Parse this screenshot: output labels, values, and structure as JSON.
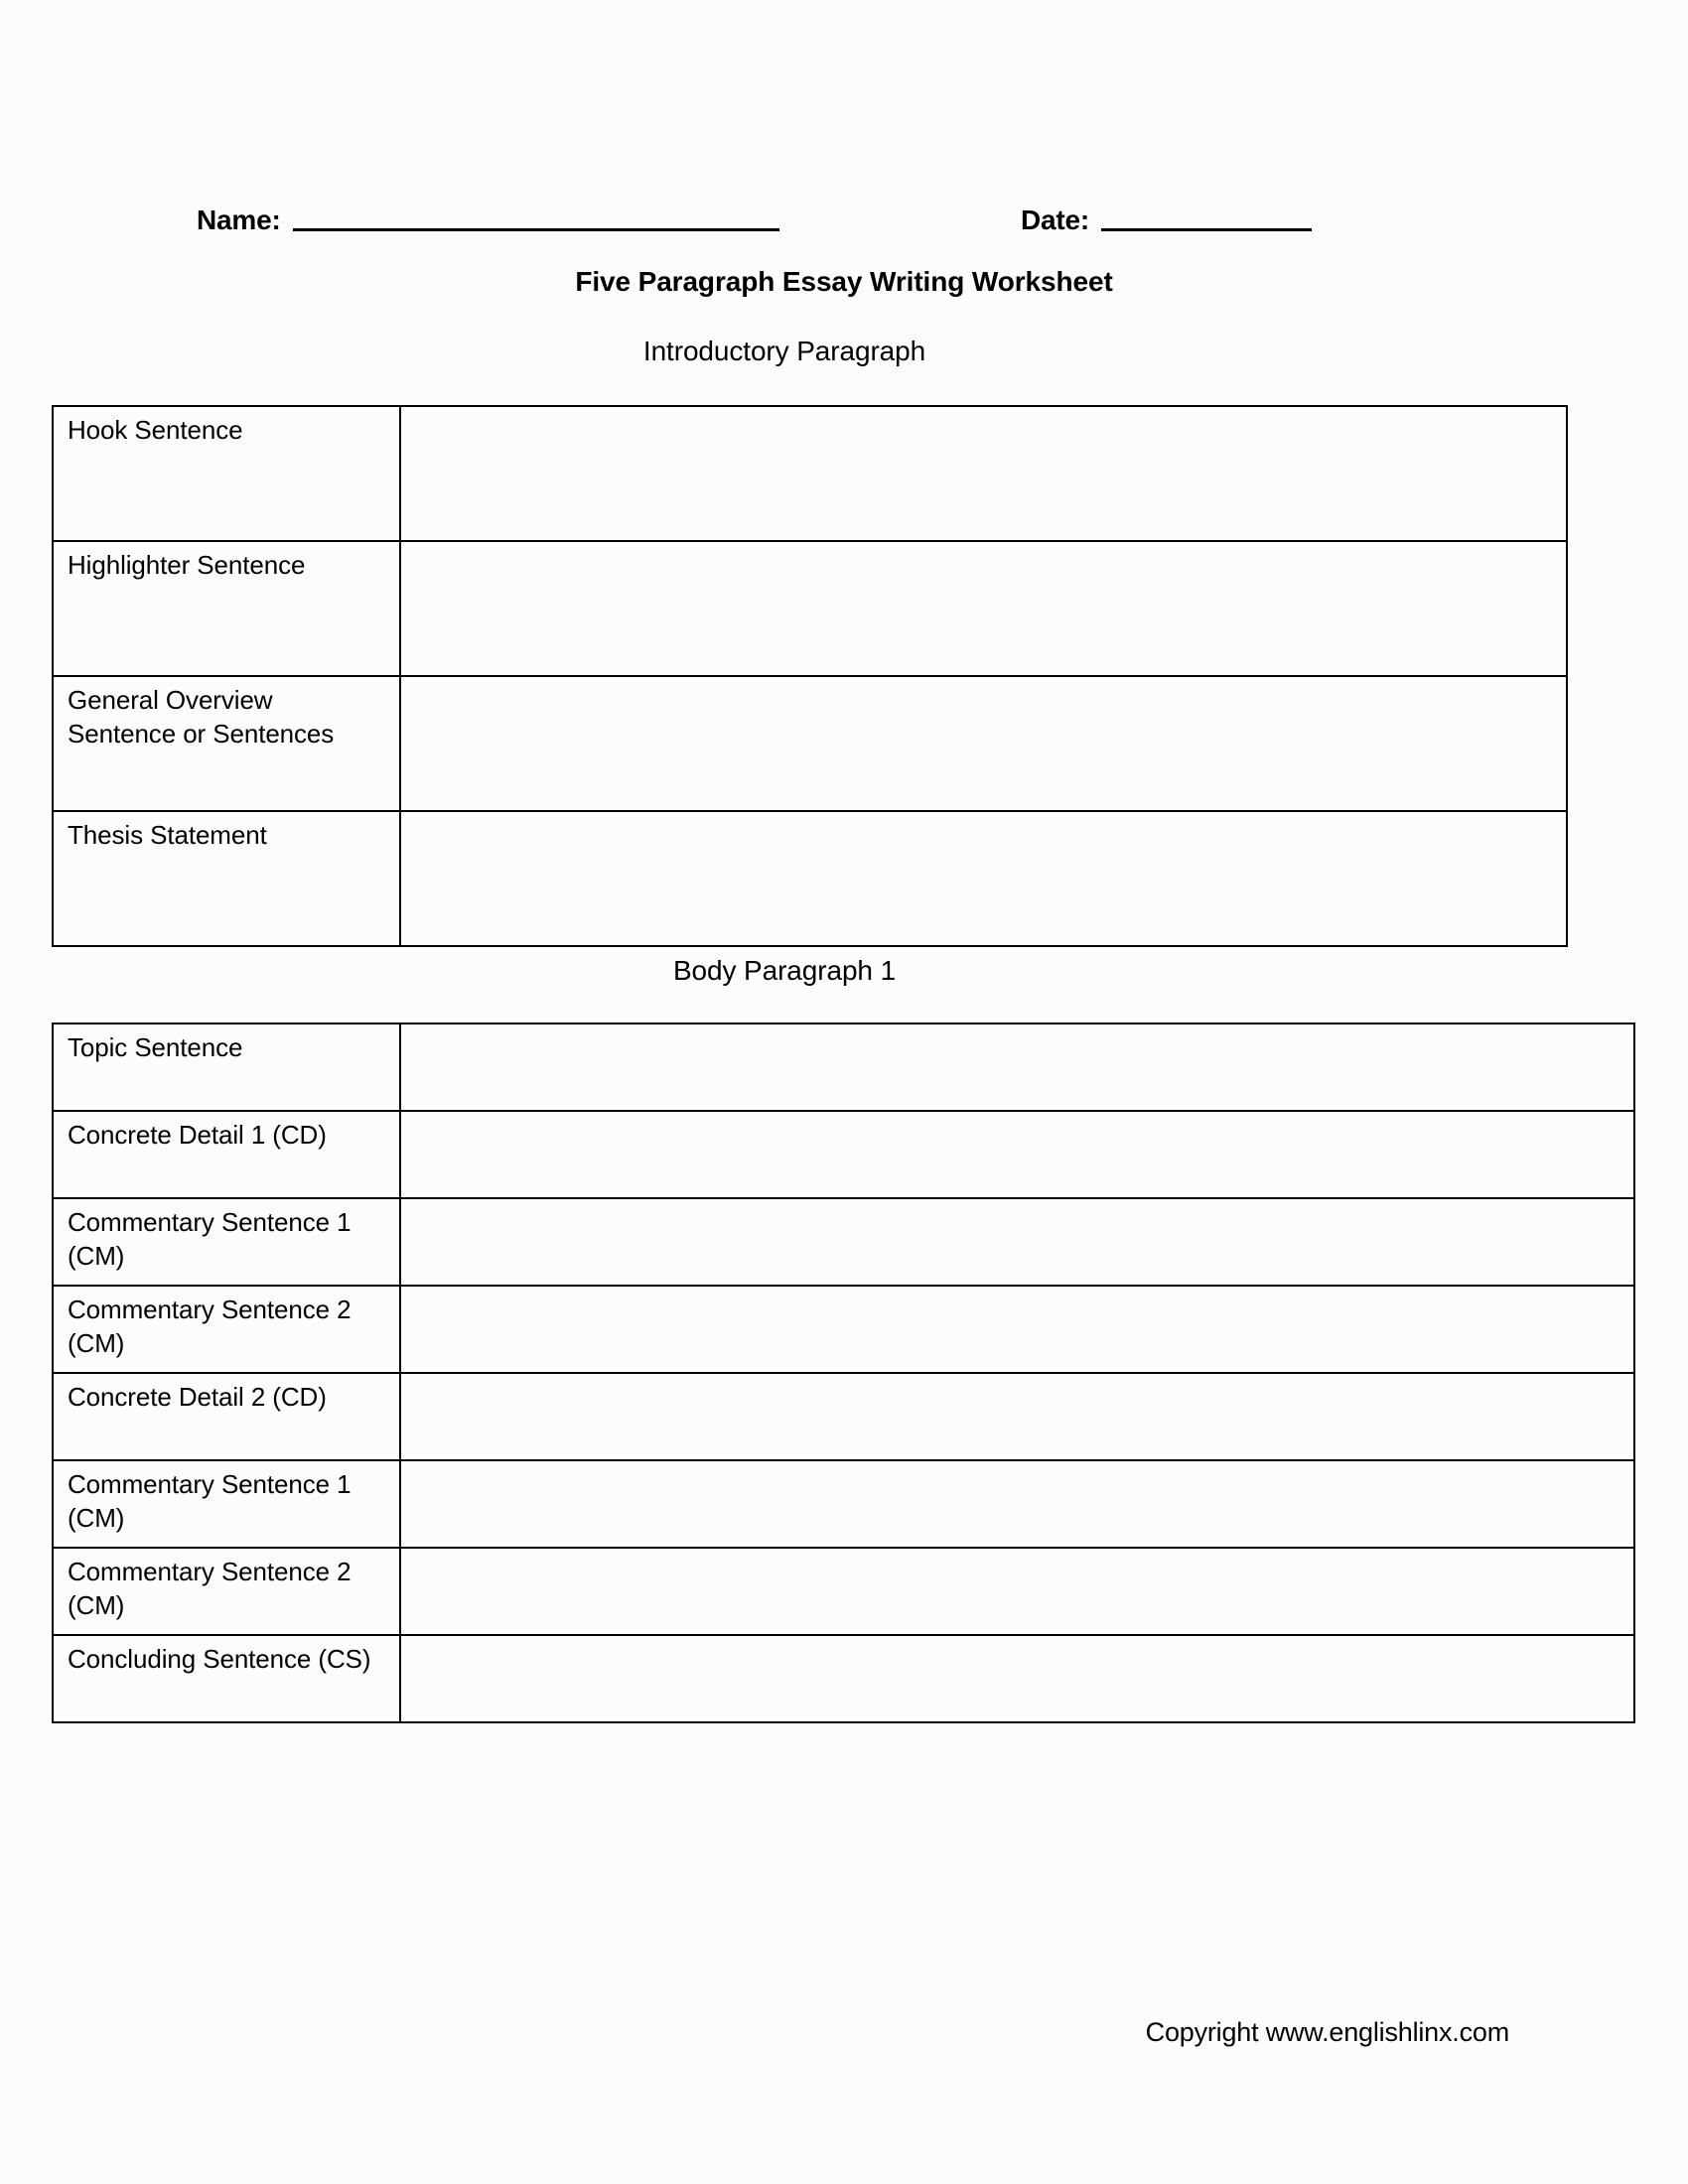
{
  "header": {
    "name_label": "Name:",
    "date_label": "Date:",
    "title": "Five Paragraph Essay Writing Worksheet"
  },
  "sections": [
    {
      "heading": "Introductory Paragraph",
      "rows": [
        {
          "label": "Hook Sentence",
          "value": ""
        },
        {
          "label": "Highlighter Sentence",
          "value": ""
        },
        {
          "label": "General Overview\nSentence or Sentences",
          "value": ""
        },
        {
          "label": "Thesis Statement",
          "value": ""
        }
      ]
    },
    {
      "heading": "Body Paragraph 1",
      "rows": [
        {
          "label": "Topic Sentence",
          "value": ""
        },
        {
          "label": "Concrete Detail 1 (CD)",
          "value": ""
        },
        {
          "label": "Commentary Sentence 1\n(CM)",
          "value": ""
        },
        {
          "label": "Commentary Sentence 2\n(CM)",
          "value": ""
        },
        {
          "label": "Concrete Detail 2 (CD)",
          "value": ""
        },
        {
          "label": "Commentary Sentence 1\n(CM)",
          "value": ""
        },
        {
          "label": "Commentary Sentence 2\n(CM)",
          "value": ""
        },
        {
          "label": "Concluding Sentence (CS)",
          "value": ""
        }
      ]
    }
  ],
  "footer": {
    "copyright": "Copyright www.englishlinx.com"
  }
}
